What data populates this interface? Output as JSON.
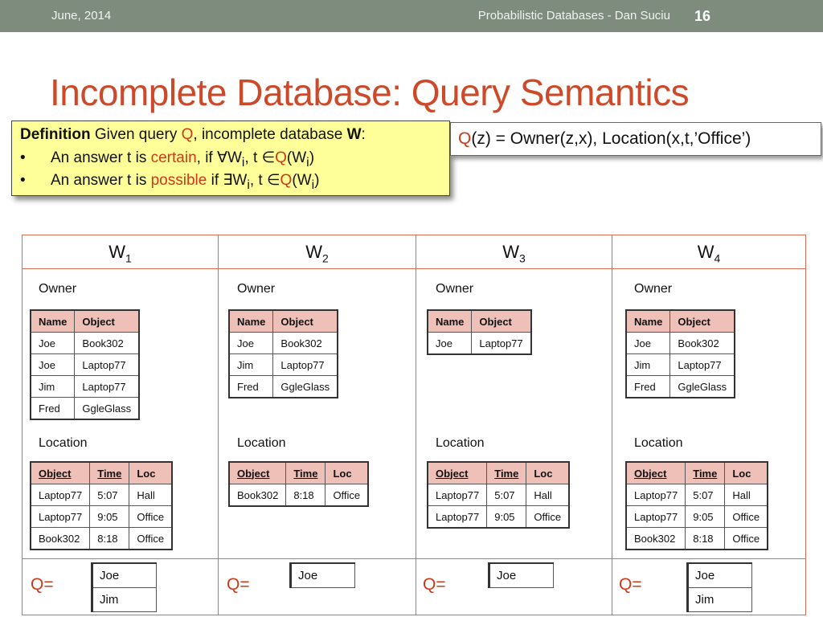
{
  "header": {
    "date": "June, 2014",
    "footer": "Probabilistic Databases - Dan Suciu",
    "slide_number": "16"
  },
  "title": "Incomplete Database: Query Semantics",
  "definition": {
    "head_bold": "Definition",
    "head_pre": " Given query ",
    "head_q": "Q",
    "head_mid": ", incomplete database ",
    "head_w": "W",
    "head_end": ":",
    "bullet": "•",
    "item1_pre": "An answer t is ",
    "item1_key": "certain",
    "item1_mid": ",  if ∀W",
    "item1_sub": "i",
    "item1_post": ",  t ∈",
    "item1_q": "Q",
    "item1_open": "(W",
    "item1_sub2": "i",
    "item1_close": ")",
    "item2_pre": "An answer t is ",
    "item2_key": "possible",
    "item2_mid": " if ∃W",
    "item2_sub": "i",
    "item2_post": ",  t ∈",
    "item2_q": "Q",
    "item2_open": "(W",
    "item2_sub2": "i",
    "item2_close": ")"
  },
  "query": {
    "q": "Q",
    "rest": "(z) = Owner(z,x), Location(x,t,’Office’)"
  },
  "worlds": [
    {
      "w": "W",
      "sub": "1",
      "owner_label": "Owner",
      "location_label": "Location",
      "q_label": "Q=",
      "owner_headers": [
        "Name",
        "Object"
      ],
      "owner_rows": [
        [
          "Joe",
          "Book302"
        ],
        [
          "Joe",
          "Laptop77"
        ],
        [
          "Jim",
          "Laptop77"
        ],
        [
          "Fred",
          "GgleGlass"
        ]
      ],
      "location_headers": [
        "Object",
        "Time",
        "Loc"
      ],
      "location_rows": [
        [
          "Laptop77",
          "5:07",
          "Hall"
        ],
        [
          "Laptop77",
          "9:05",
          "Office"
        ],
        [
          "Book302",
          "8:18",
          "Office"
        ]
      ],
      "answers": [
        "Joe",
        "Jim"
      ]
    },
    {
      "w": "W",
      "sub": "2",
      "owner_label": "Owner",
      "location_label": "Location",
      "q_label": "Q=",
      "owner_headers": [
        "Name",
        "Object"
      ],
      "owner_rows": [
        [
          "Joe",
          "Book302"
        ],
        [
          "Jim",
          "Laptop77"
        ],
        [
          "Fred",
          "GgleGlass"
        ]
      ],
      "location_headers": [
        "Object",
        "Time",
        "Loc"
      ],
      "location_rows": [
        [
          "Book302",
          "8:18",
          "Office"
        ]
      ],
      "answers": [
        "Joe"
      ]
    },
    {
      "w": "W",
      "sub": "3",
      "owner_label": "Owner",
      "location_label": "Location",
      "q_label": "Q=",
      "owner_headers": [
        "Name",
        "Object"
      ],
      "owner_rows": [
        [
          "Joe",
          "Laptop77"
        ]
      ],
      "location_headers": [
        "Object",
        "Time",
        "Loc"
      ],
      "location_rows": [
        [
          "Laptop77",
          "5:07",
          "Hall"
        ],
        [
          "Laptop77",
          "9:05",
          "Office"
        ]
      ],
      "answers": [
        "Joe"
      ]
    },
    {
      "w": "W",
      "sub": "4",
      "owner_label": "Owner",
      "location_label": "Location",
      "q_label": "Q=",
      "owner_headers": [
        "Name",
        "Object"
      ],
      "owner_rows": [
        [
          "Joe",
          "Book302"
        ],
        [
          "Jim",
          "Laptop77"
        ],
        [
          "Fred",
          "GgleGlass"
        ]
      ],
      "location_headers": [
        "Object",
        "Time",
        "Loc"
      ],
      "location_rows": [
        [
          "Laptop77",
          "5:07",
          "Hall"
        ],
        [
          "Laptop77",
          "9:05",
          "Office"
        ],
        [
          "Book302",
          "8:18",
          "Office"
        ]
      ],
      "answers": [
        "Joe",
        "Jim"
      ]
    }
  ]
}
